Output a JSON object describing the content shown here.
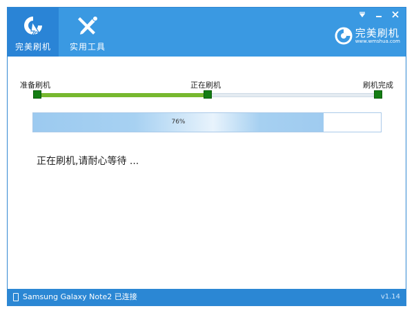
{
  "tabs": [
    {
      "label": "完美刷机",
      "icon": "flash-cursor-icon"
    },
    {
      "label": "实用工具",
      "icon": "tools-icon"
    }
  ],
  "brand": {
    "name": "完美刷机",
    "url": "www.wmshua.com"
  },
  "steps": {
    "start": "准备刷机",
    "middle": "正在刷机",
    "end": "刷机完成"
  },
  "progress": {
    "value": 0.76,
    "label": "76%"
  },
  "status_message": "正在刷机,请耐心等待 ...",
  "footer": {
    "device": "Samsung Galaxy Note2 已连接",
    "version": "v1.14"
  },
  "colors": {
    "titlebar": "#3a99e2",
    "accent": "#2a84d6",
    "step_fill": "#77b82f",
    "node": "#147d13"
  }
}
